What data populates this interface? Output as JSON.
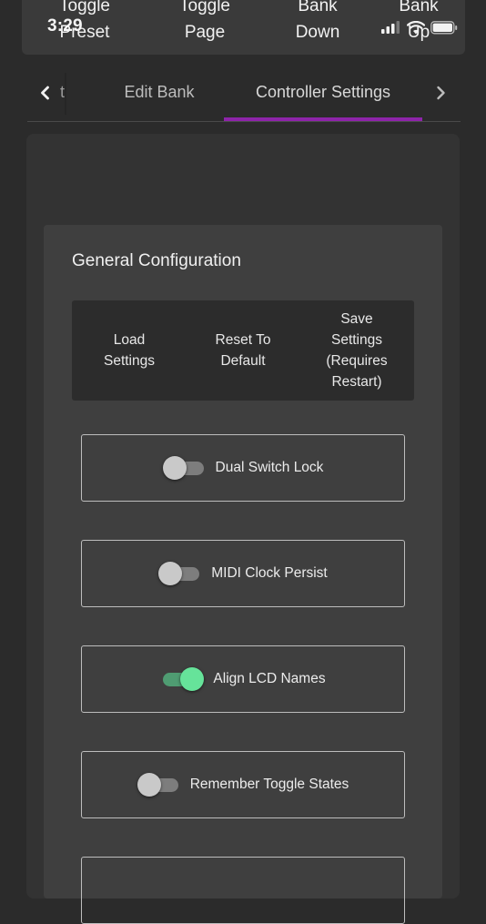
{
  "status_bar": {
    "time": "3:29"
  },
  "top_buttons": [
    {
      "line1": "Toggle",
      "line2": "Preset"
    },
    {
      "line1": "Toggle",
      "line2": "Page"
    },
    {
      "line1": "Bank",
      "line2": "Down"
    },
    {
      "line1": "Bank",
      "line2": "Up"
    }
  ],
  "tabs": {
    "partial_left": "t",
    "items": [
      {
        "label": "Edit Bank",
        "active": false
      },
      {
        "label": "Controller Settings",
        "active": true
      }
    ],
    "accent_color": "#8e24aa"
  },
  "general": {
    "title": "General Configuration",
    "actions": [
      {
        "label": "Load Settings"
      },
      {
        "label": "Reset To Default"
      },
      {
        "label": "Save Settings (Requires Restart)"
      }
    ],
    "toggles": [
      {
        "label": "Dual Switch Lock",
        "on": false
      },
      {
        "label": "MIDI Clock Persist",
        "on": false
      },
      {
        "label": "Align LCD Names",
        "on": true
      },
      {
        "label": "Remember Toggle States",
        "on": false
      }
    ],
    "toggle_on_color": "#66e39a"
  }
}
